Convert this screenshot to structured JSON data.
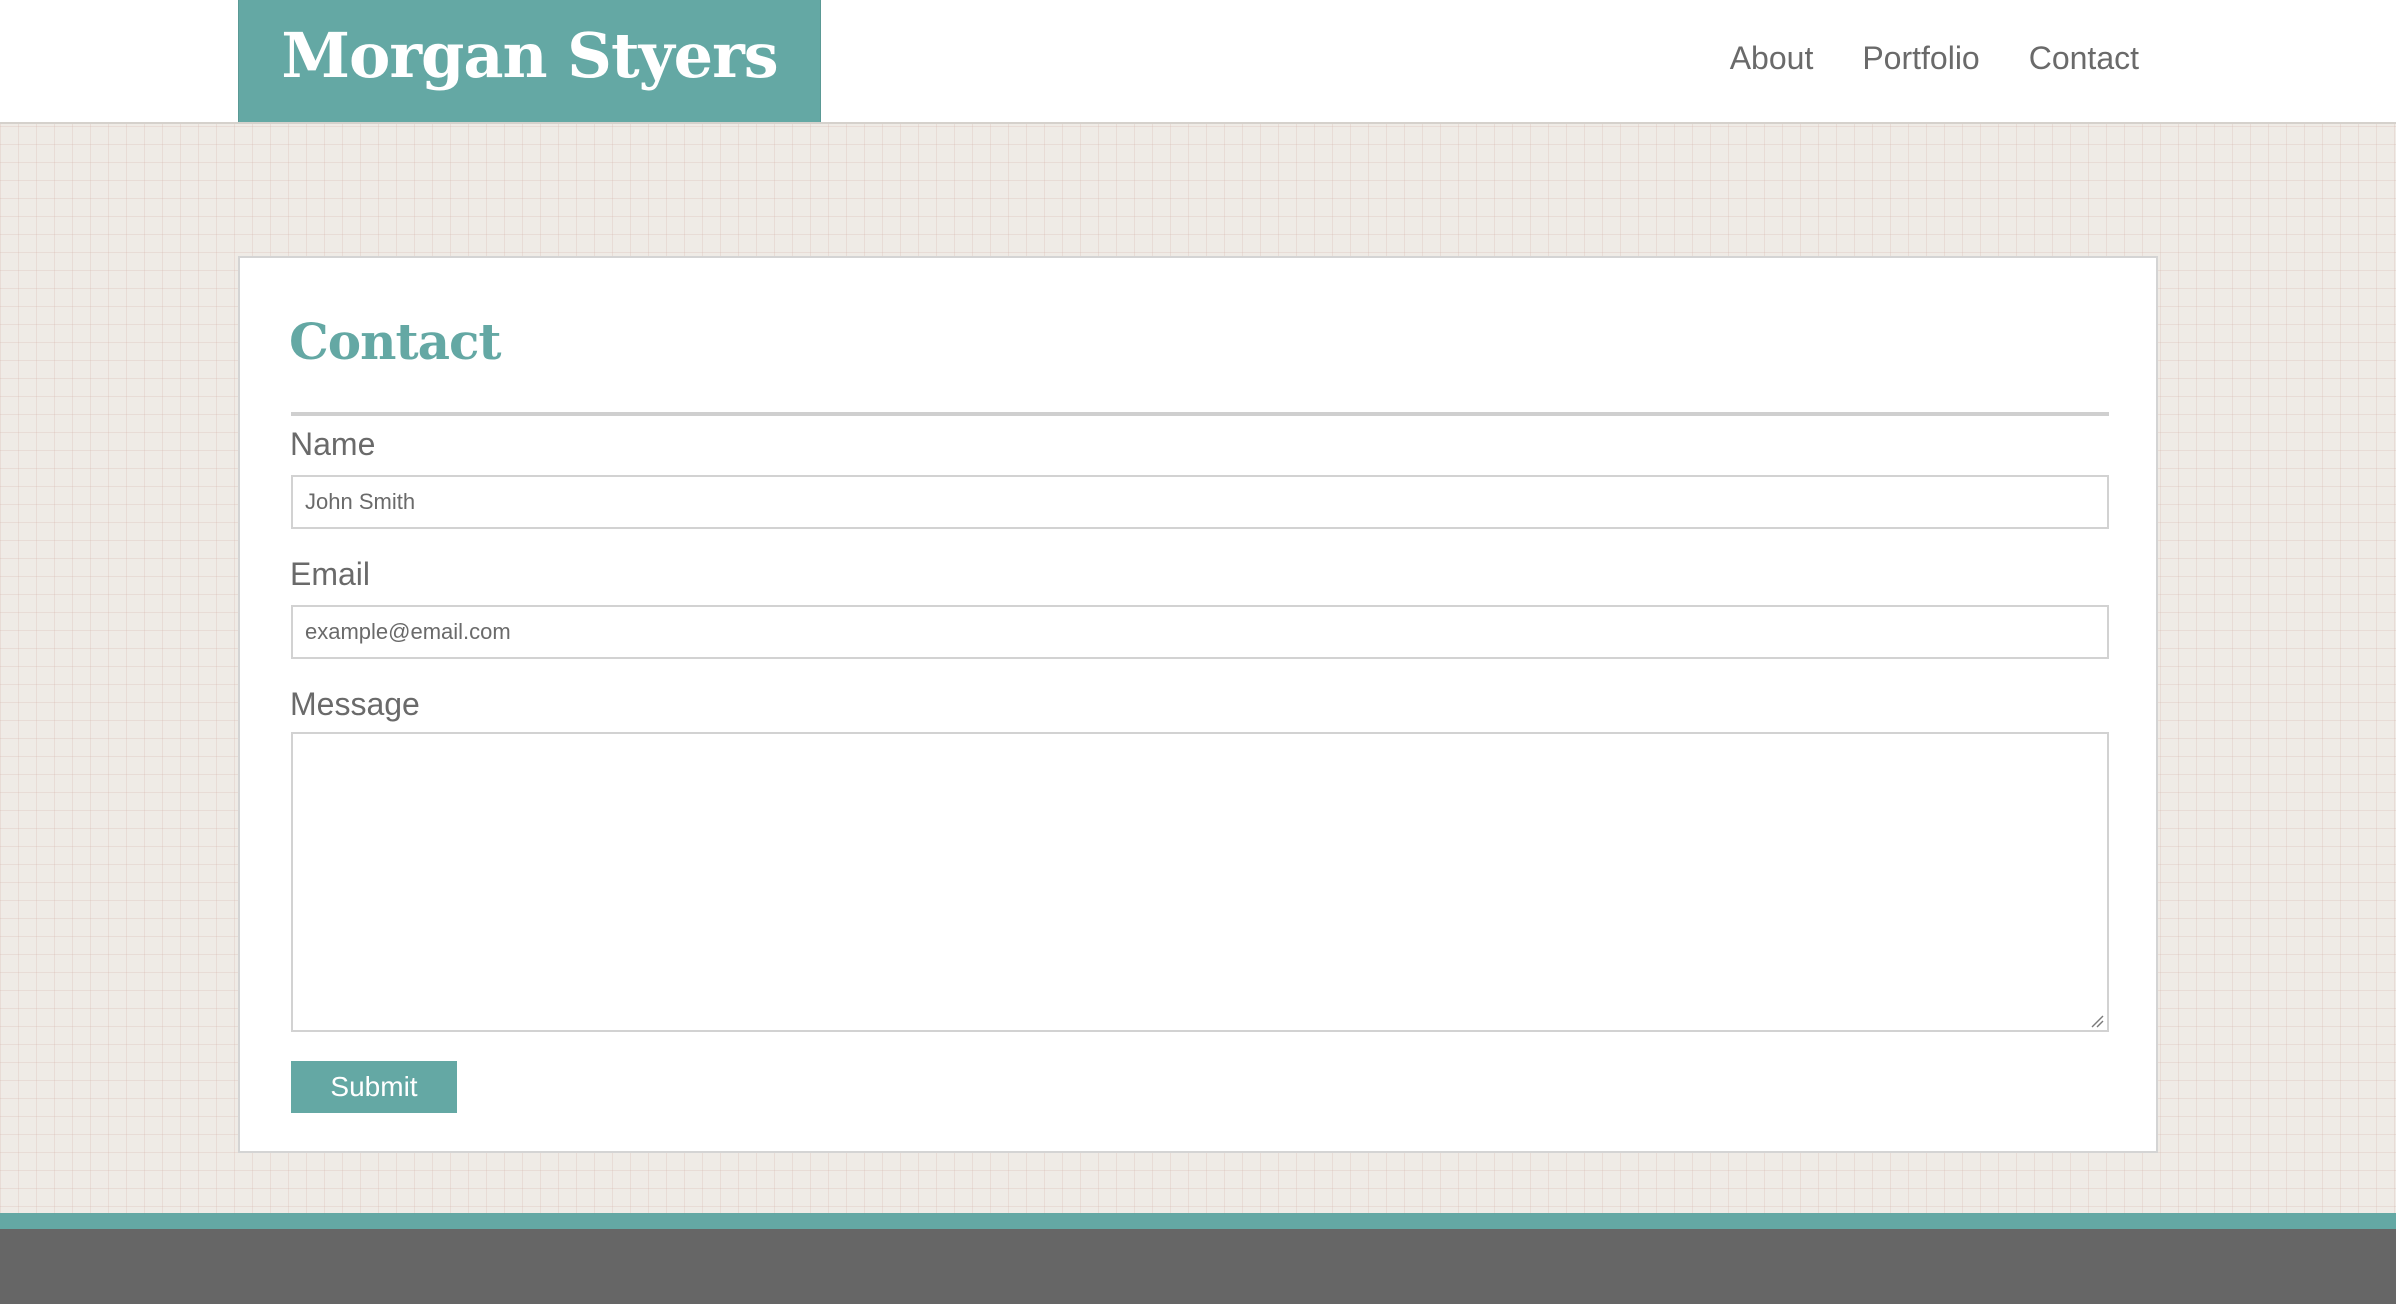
{
  "site": {
    "title": "Morgan Styers",
    "accent_color": "#64a8a4"
  },
  "nav": {
    "items": [
      {
        "label": "About"
      },
      {
        "label": "Portfolio"
      },
      {
        "label": "Contact"
      }
    ]
  },
  "contact": {
    "title": "Contact",
    "name_label": "Name",
    "name_placeholder": "John Smith",
    "email_label": "Email",
    "email_placeholder": "example@email.com",
    "message_label": "Message",
    "message_value": "",
    "submit_label": "Submit"
  },
  "icons": {
    "resize_grip": "resize-grip-icon"
  }
}
